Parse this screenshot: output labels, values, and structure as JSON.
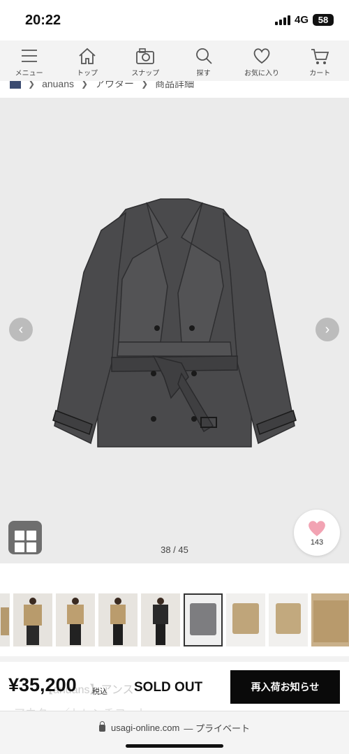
{
  "status": {
    "time": "20:22",
    "network": "4G",
    "battery": "58"
  },
  "nav": {
    "items": [
      {
        "label": "メニュー",
        "icon": "menu-icon"
      },
      {
        "label": "トップ",
        "icon": "home-icon"
      },
      {
        "label": "スナップ",
        "icon": "camera-icon"
      },
      {
        "label": "探す",
        "icon": "search-icon"
      },
      {
        "label": "お気に入り",
        "icon": "heart-icon"
      },
      {
        "label": "カート",
        "icon": "cart-icon"
      }
    ]
  },
  "breadcrumb": {
    "items": [
      "anuans",
      "アウター",
      "商品詳細"
    ]
  },
  "gallery": {
    "counter": "38 / 45",
    "favorite_count": "143",
    "coat_color": "#4a4a4c"
  },
  "thumbnails": {
    "count_visible": 9,
    "selected_index": 5
  },
  "purchase": {
    "price": "¥35,200",
    "tax_label": "税込",
    "status": "SOLD OUT",
    "restock_button": "再入荷お知らせ",
    "product_name_line1": "【anuans】アンス",
    "product_name_line2": "アウター／トレンチコート"
  },
  "browser": {
    "domain": "usagi-online.com",
    "mode": "— プライベート"
  },
  "colors": {
    "accent": "#0a0a0a",
    "heart": "#f2a3b3",
    "nav_bg": "#f3f3f3",
    "gallery_bg": "#ebebeb"
  }
}
